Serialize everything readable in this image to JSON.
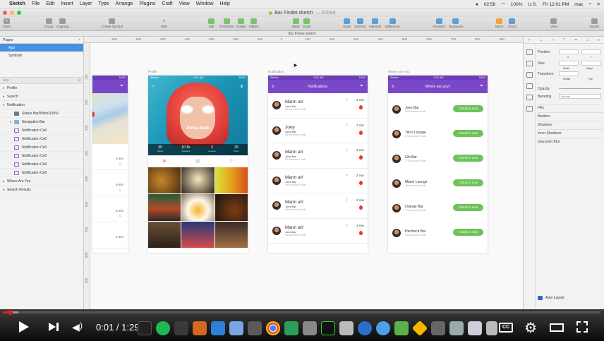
{
  "menubar": {
    "apple": "",
    "items": [
      "Sketch",
      "File",
      "Edit",
      "Insert",
      "Layer",
      "Type",
      "Arrange",
      "Plugins",
      "Craft",
      "View",
      "Window",
      "Help"
    ],
    "clock": "02:58",
    "battery": "100%",
    "input": "U.S.",
    "datetime": "Fri 12:01 PM",
    "user": "mac"
  },
  "window": {
    "title": "Bar Finder.sketch",
    "edited": "— Edited"
  },
  "toolbar": {
    "insert": "Insert",
    "group": "Group",
    "ungroup": "Ungroup",
    "create_symbol": "Create Symbol",
    "zoom": "85%",
    "edit": "Edit",
    "transform": "Transform",
    "rotate": "Rotate",
    "flatten": "Flatten",
    "mask": "Mask",
    "scale": "Scale",
    "union": "Union",
    "subtract": "Subtract",
    "intersect": "Intersect",
    "difference": "Difference",
    "forward": "Forward",
    "backward": "Backward",
    "mirror": "Mirror",
    "cloud": "Cloud",
    "view": "View",
    "export": "Export"
  },
  "doc_strip": "Bar Finder.sketch",
  "layers": {
    "pages_label": "Pages",
    "pages": [
      "App",
      "Symbols"
    ],
    "search_placeholder": "App",
    "rows": [
      {
        "label": "Profile",
        "type": "group"
      },
      {
        "label": "Search",
        "type": "group"
      },
      {
        "label": "Notification",
        "type": "group-open"
      },
      {
        "label": "Status Bar/White/100%",
        "type": "status"
      },
      {
        "label": "Navigation Bar",
        "type": "folder"
      },
      {
        "label": "Notification Cell",
        "type": "symbol"
      },
      {
        "label": "Notification Cell",
        "type": "symbol"
      },
      {
        "label": "Notification Cell",
        "type": "symbol"
      },
      {
        "label": "Notification Cell",
        "type": "symbol"
      },
      {
        "label": "Notification Cell",
        "type": "symbol"
      },
      {
        "label": "Notification Cell",
        "type": "symbol"
      },
      {
        "label": "Where Are You",
        "type": "group"
      },
      {
        "label": "Search Results",
        "type": "group"
      }
    ]
  },
  "ruler_h": [
    "-800",
    "-600",
    "-500",
    "-400",
    "-300",
    "-200",
    "-100",
    "0",
    "100",
    "200",
    "300",
    "400",
    "500",
    "600",
    "700",
    "800",
    "900"
  ],
  "ruler_v": [
    "100",
    "200",
    "300",
    "400",
    "500",
    "600",
    "700",
    "800",
    "900"
  ],
  "artboards": {
    "profile_label": "Profile",
    "notification_label": "Notification",
    "where_label": "Where Are You"
  },
  "status_bar": {
    "carrier": "Sketch",
    "time": "9:41 AM",
    "battery": "100%"
  },
  "back_list": {
    "times": [
      "3 min",
      "9 min",
      "3 min",
      "3 min"
    ]
  },
  "profile": {
    "name": "Alexa Bain",
    "stats": [
      {
        "value": "55",
        "label": "Places"
      },
      {
        "value": "10.1k",
        "label": "Followers"
      },
      {
        "value": "3",
        "label": "Lessons"
      },
      {
        "value": "29",
        "label": "Food"
      }
    ]
  },
  "notification": {
    "title": "Notifications",
    "cells": [
      {
        "name": "Mann ah'",
        "bar": "Joes Bar",
        "addr": "95 Baumbach Falls",
        "time": "3 min"
      },
      {
        "name": "Joey",
        "bar": "Joes Bar",
        "addr": "95 Baumbach Falls",
        "time": "3 min"
      },
      {
        "name": "Mann ah'",
        "bar": "Joes Bar",
        "addr": "95 Baumbach Falls",
        "time": "3 min"
      },
      {
        "name": "Mann ah'",
        "bar": "Joes Bar",
        "addr": "95 Baumbach Falls",
        "time": "3 min"
      },
      {
        "name": "Mann ah'",
        "bar": "Joes Bar",
        "addr": "95 Baumbach Falls",
        "time": "3 min"
      },
      {
        "name": "Mann ah'",
        "bar": "Joes Bar",
        "addr": "95 Baumbach Falls",
        "time": "3 min"
      }
    ]
  },
  "where": {
    "title": "Where are you?",
    "checkin": "Check in now",
    "bars": [
      {
        "name": "Joes Bar",
        "addr": "95 Baumbach Falls"
      },
      {
        "name": "Tito's Lounge",
        "addr": "67 Baumbach Falls"
      },
      {
        "name": "k2s Bar",
        "addr": "77 Baumbach Falls"
      },
      {
        "name": "Miami Lounge",
        "addr": "95 Baumbach Falls"
      },
      {
        "name": "Orange Bar",
        "addr": "77 Baumbach Falls"
      },
      {
        "name": "Hardrock Bar",
        "addr": "95 Baumbach Falls"
      }
    ]
  },
  "inspector": {
    "position": "Position",
    "x": "X",
    "y": "Y",
    "size": "Size",
    "width": "Width",
    "height": "Height",
    "transform": "Transform",
    "rotate": "Rotate",
    "flip": "Flip",
    "opacity": "Opacity",
    "blending": "Blending",
    "blend_mode": "Normal",
    "fills": "Fills",
    "borders": "Borders",
    "shadows": "Shadows",
    "inner_shadows": "Inner Shadows",
    "gaussian": "Gaussian Blur",
    "auto_layout": "Auto Layout"
  },
  "player": {
    "time": "0:01 / 1:29",
    "cc": "CC",
    "played": 0.012,
    "buffered": 0.026
  },
  "colors": {
    "accent": "#7a47c8",
    "checkin": "#6dc35a",
    "progress": "#e21e1e",
    "selection": "#4a90e2"
  }
}
